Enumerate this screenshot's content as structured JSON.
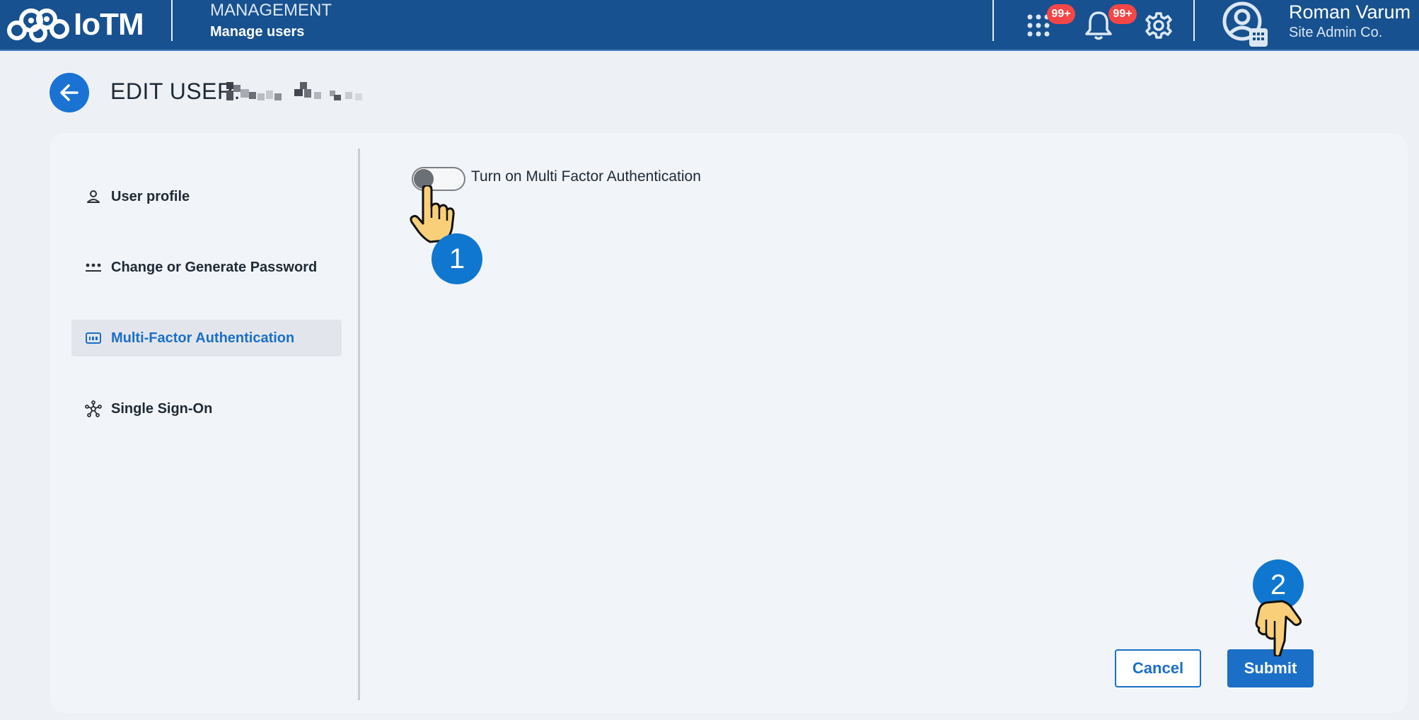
{
  "header": {
    "logo_text": "IoTM",
    "section": "MANAGEMENT",
    "subsection": "Manage users",
    "apps_badge": "99+",
    "notifications_badge": "99+",
    "user_name": "Roman Varum",
    "user_org": "Site Admin Co."
  },
  "page": {
    "title": "EDIT USER:"
  },
  "sidebar": {
    "items": [
      {
        "label": "User profile",
        "icon": "person-icon"
      },
      {
        "label": "Change or Generate Password",
        "icon": "password-dots-icon"
      },
      {
        "label": "Multi-Factor Authentication",
        "icon": "numeric-keypad-icon",
        "active": true
      },
      {
        "label": "Single Sign-On",
        "icon": "network-hub-icon"
      }
    ]
  },
  "mfa": {
    "toggle_label": "Turn on Multi Factor Authentication",
    "enabled": false
  },
  "actions": {
    "cancel": "Cancel",
    "submit": "Submit"
  },
  "annotations": {
    "step1": "1",
    "step2": "2"
  },
  "colors": {
    "topbar": "#17518f",
    "accent": "#1b6fc7",
    "badge": "#f44646",
    "step_marker": "#0f77d0"
  }
}
